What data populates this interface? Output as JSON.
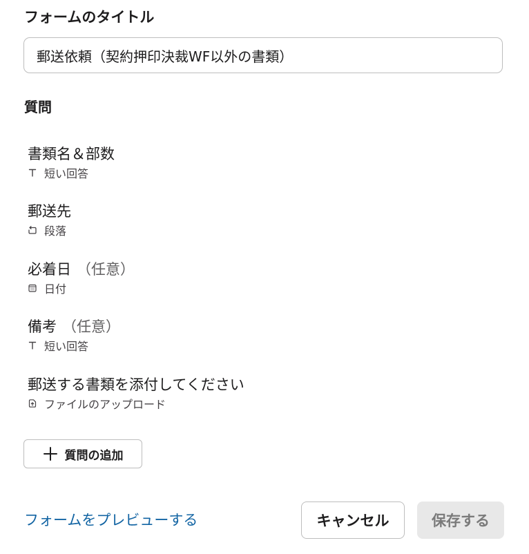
{
  "form": {
    "title_label": "フォームのタイトル",
    "title_value": "郵送依頼（契約押印決裁WF以外の書類）"
  },
  "questions": {
    "heading": "質問",
    "items": [
      {
        "title": "書類名＆部数",
        "optional": "",
        "type_label": "短い回答",
        "type_icon": "text-type-icon"
      },
      {
        "title": "郵送先",
        "optional": "",
        "type_label": "段落",
        "type_icon": "paragraph-icon"
      },
      {
        "title": "必着日",
        "optional": "（任意）",
        "type_label": "日付",
        "type_icon": "calendar-icon"
      },
      {
        "title": "備考",
        "optional": "（任意）",
        "type_label": "短い回答",
        "type_icon": "text-type-icon"
      },
      {
        "title": "郵送する書類を添付してください",
        "optional": "",
        "type_label": "ファイルのアップロード",
        "type_icon": "file-upload-icon"
      }
    ]
  },
  "actions": {
    "add_question_label": "質問の追加",
    "preview_label": "フォームをプレビューする",
    "cancel_label": "キャンセル",
    "save_label": "保存する"
  },
  "colors": {
    "link": "#1264a3",
    "border": "#bdbdbd",
    "disabled_button_bg": "#e8e8e8",
    "disabled_button_text": "#7a7a7a",
    "text": "#1d1c1d"
  }
}
